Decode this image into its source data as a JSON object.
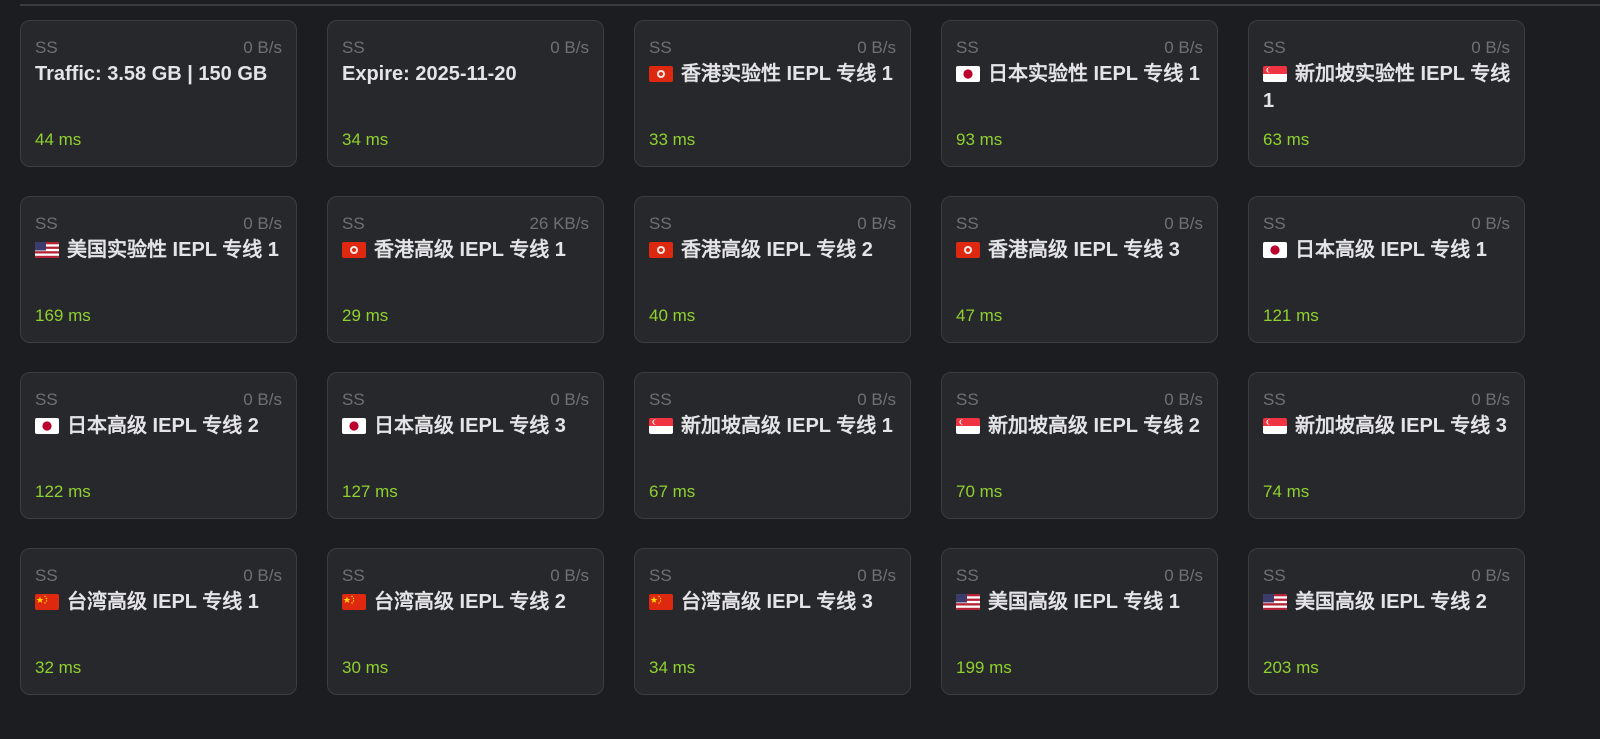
{
  "colors": {
    "background": "#1c1d20",
    "card": "#27282b",
    "latency_good": "#8fd12e",
    "muted": "#6f7075",
    "text": "#e4e4e6"
  },
  "proxies": [
    {
      "type": "SS",
      "speed": "0 B/s",
      "flag": "",
      "name": "Traffic: 3.58 GB | 150 GB",
      "latency": "44 ms"
    },
    {
      "type": "SS",
      "speed": "0 B/s",
      "flag": "",
      "name": "Expire: 2025-11-20",
      "latency": "34 ms"
    },
    {
      "type": "SS",
      "speed": "0 B/s",
      "flag": "hk",
      "name": "香港实验性 IEPL 专线 1",
      "latency": "33 ms"
    },
    {
      "type": "SS",
      "speed": "0 B/s",
      "flag": "jp",
      "name": "日本实验性 IEPL 专线 1",
      "latency": "93 ms"
    },
    {
      "type": "SS",
      "speed": "0 B/s",
      "flag": "sg",
      "name": "新加坡实验性 IEPL 专线 1",
      "latency": "63 ms"
    },
    {
      "type": "SS",
      "speed": "0 B/s",
      "flag": "us",
      "name": "美国实验性 IEPL 专线 1",
      "latency": "169 ms"
    },
    {
      "type": "SS",
      "speed": "26 KB/s",
      "flag": "hk",
      "name": "香港高级 IEPL 专线 1",
      "latency": "29 ms"
    },
    {
      "type": "SS",
      "speed": "0 B/s",
      "flag": "hk",
      "name": "香港高级 IEPL 专线 2",
      "latency": "40 ms"
    },
    {
      "type": "SS",
      "speed": "0 B/s",
      "flag": "hk",
      "name": "香港高级 IEPL 专线 3",
      "latency": "47 ms"
    },
    {
      "type": "SS",
      "speed": "0 B/s",
      "flag": "jp",
      "name": "日本高级 IEPL 专线 1",
      "latency": "121 ms"
    },
    {
      "type": "SS",
      "speed": "0 B/s",
      "flag": "jp",
      "name": "日本高级 IEPL 专线 2",
      "latency": "122 ms"
    },
    {
      "type": "SS",
      "speed": "0 B/s",
      "flag": "jp",
      "name": "日本高级 IEPL 专线 3",
      "latency": "127 ms"
    },
    {
      "type": "SS",
      "speed": "0 B/s",
      "flag": "sg",
      "name": "新加坡高级 IEPL 专线 1",
      "latency": "67 ms"
    },
    {
      "type": "SS",
      "speed": "0 B/s",
      "flag": "sg",
      "name": "新加坡高级 IEPL 专线 2",
      "latency": "70 ms"
    },
    {
      "type": "SS",
      "speed": "0 B/s",
      "flag": "sg",
      "name": "新加坡高级 IEPL 专线 3",
      "latency": "74 ms"
    },
    {
      "type": "SS",
      "speed": "0 B/s",
      "flag": "cn",
      "name": "台湾高级 IEPL 专线 1",
      "latency": "32 ms"
    },
    {
      "type": "SS",
      "speed": "0 B/s",
      "flag": "cn",
      "name": "台湾高级 IEPL 专线 2",
      "latency": "30 ms"
    },
    {
      "type": "SS",
      "speed": "0 B/s",
      "flag": "cn",
      "name": "台湾高级 IEPL 专线 3",
      "latency": "34 ms"
    },
    {
      "type": "SS",
      "speed": "0 B/s",
      "flag": "us",
      "name": "美国高级 IEPL 专线 1",
      "latency": "199 ms"
    },
    {
      "type": "SS",
      "speed": "0 B/s",
      "flag": "us",
      "name": "美国高级 IEPL 专线 2",
      "latency": "203 ms"
    }
  ]
}
